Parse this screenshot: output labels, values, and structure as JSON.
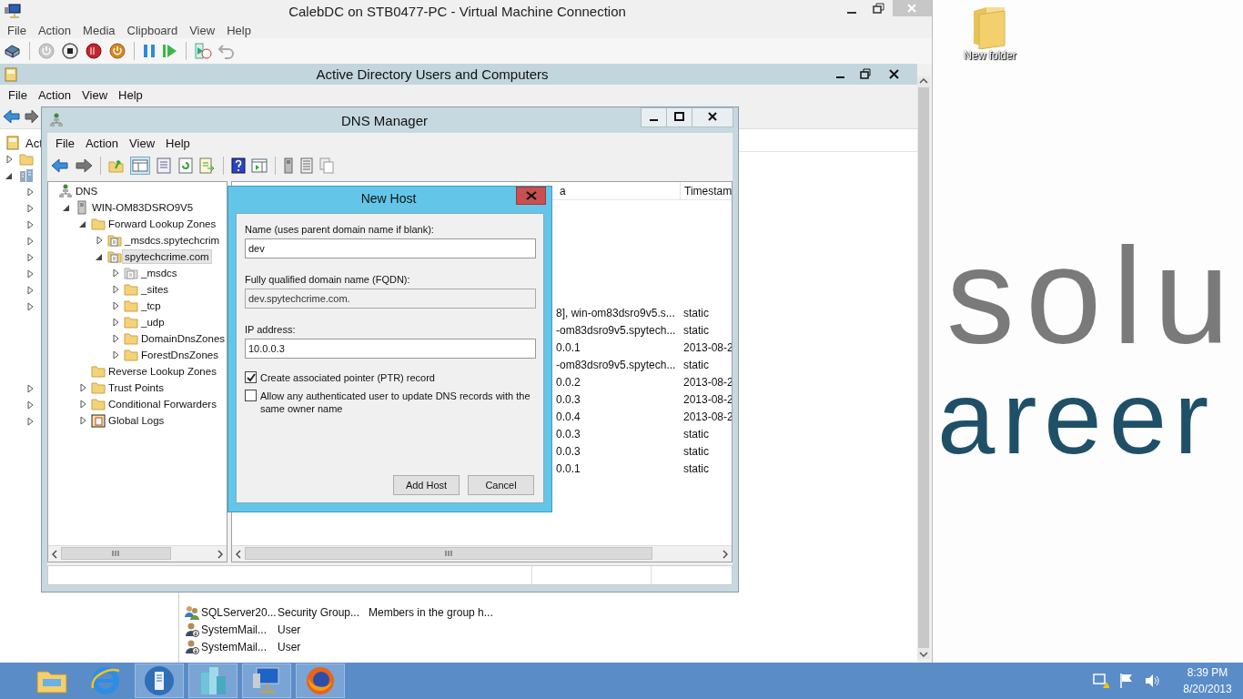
{
  "vm_window": {
    "title": "CalebDC on STB0477-PC - Virtual Machine Connection",
    "menu": [
      "File",
      "Action",
      "Media",
      "Clipboard",
      "View",
      "Help"
    ]
  },
  "ad_window": {
    "title": "Active Directory Users and Computers",
    "menu": [
      "File",
      "Action",
      "View",
      "Help"
    ],
    "tree_root": "Act",
    "rows": [
      {
        "name": "SQLServer20...",
        "type": "Security Group...",
        "description": "Members in the group h...",
        "kind": "group"
      },
      {
        "name": "SystemMail...",
        "type": "User",
        "kind": "user"
      },
      {
        "name": "SystemMail...",
        "type": "User",
        "kind": "user"
      }
    ]
  },
  "dns_window": {
    "title": "DNS Manager",
    "menu": [
      "File",
      "Action",
      "View",
      "Help"
    ],
    "tree": [
      {
        "label": "DNS",
        "kind": "root",
        "selected": false,
        "children": [
          {
            "label": "WIN-OM83DSRO9V5",
            "kind": "server",
            "expanded": true,
            "selected": false,
            "children": [
              {
                "label": "Forward Lookup Zones",
                "kind": "folder",
                "expanded": true,
                "selected": false,
                "children": [
                  {
                    "label": "_msdcs.spytechcrim",
                    "kind": "zone",
                    "expanded": false,
                    "selected": false
                  },
                  {
                    "label": "spytechcrime.com",
                    "kind": "zone",
                    "expanded": true,
                    "selected": true,
                    "children": [
                      {
                        "label": "_msdcs",
                        "kind": "delegation",
                        "expanded": false,
                        "selected": false
                      },
                      {
                        "label": "_sites",
                        "kind": "folder",
                        "expanded": false,
                        "selected": false
                      },
                      {
                        "label": "_tcp",
                        "kind": "folder",
                        "expanded": false,
                        "selected": false
                      },
                      {
                        "label": "_udp",
                        "kind": "folder",
                        "expanded": false,
                        "selected": false
                      },
                      {
                        "label": "DomainDnsZones",
                        "kind": "folder",
                        "expanded": false,
                        "selected": false
                      },
                      {
                        "label": "ForestDnsZones",
                        "kind": "folder",
                        "expanded": false,
                        "selected": false
                      }
                    ]
                  }
                ]
              },
              {
                "label": "Reverse Lookup Zones",
                "kind": "folder",
                "selected": false
              },
              {
                "label": "Trust Points",
                "kind": "folder",
                "expanded": false,
                "selected": false
              },
              {
                "label": "Conditional Forwarders",
                "kind": "folder",
                "expanded": false,
                "selected": false
              },
              {
                "label": "Global Logs",
                "kind": "log",
                "expanded": false,
                "selected": false
              }
            ]
          }
        ]
      }
    ],
    "columns": [
      "a",
      "Timestam"
    ],
    "rows": [
      {
        "data": "8], win-om83dsro9v5.s...",
        "timestamp": "static"
      },
      {
        "data": "-om83dsro9v5.spytech...",
        "timestamp": "static"
      },
      {
        "data": "0.0.1",
        "timestamp": "2013-08-2"
      },
      {
        "data": "-om83dsro9v5.spytech...",
        "timestamp": "static"
      },
      {
        "data": "0.0.2",
        "timestamp": "2013-08-2"
      },
      {
        "data": "0.0.3",
        "timestamp": "2013-08-2"
      },
      {
        "data": "0.0.4",
        "timestamp": "2013-08-2"
      },
      {
        "data": "0.0.3",
        "timestamp": "static"
      },
      {
        "data": "0.0.3",
        "timestamp": "static"
      },
      {
        "data": "0.0.1",
        "timestamp": "static"
      }
    ]
  },
  "dialog": {
    "title": "New Host",
    "fields": [
      {
        "label": "Name (uses parent domain name if blank):",
        "value": "dev",
        "disabled": false
      },
      {
        "label": "Fully qualified domain name (FQDN):",
        "value": "dev.spytechcrime.com.",
        "disabled": true
      },
      {
        "label": "IP address:",
        "value": "10.0.0.3",
        "disabled": false
      }
    ],
    "checkboxes": [
      {
        "label": "Create associated pointer (PTR) record",
        "checked": true
      },
      {
        "label": "Allow any authenticated user to update DNS records with the same owner name",
        "checked": false
      }
    ],
    "buttons": [
      "Add Host",
      "Cancel"
    ]
  },
  "desktop": {
    "icons": [
      {
        "label": "New folder"
      }
    ],
    "wallpaper_text": [
      "solu",
      "areer"
    ]
  },
  "taskbar": {
    "apps": [
      {
        "kind": "explorer",
        "running": false
      },
      {
        "kind": "browser",
        "running": false
      },
      {
        "kind": "tablet",
        "running": true
      },
      {
        "kind": "buildings",
        "running": true
      },
      {
        "kind": "computer",
        "running": true
      },
      {
        "kind": "firefox",
        "running": true
      }
    ],
    "time": "8:39 PM",
    "date": "8/20/2013"
  }
}
